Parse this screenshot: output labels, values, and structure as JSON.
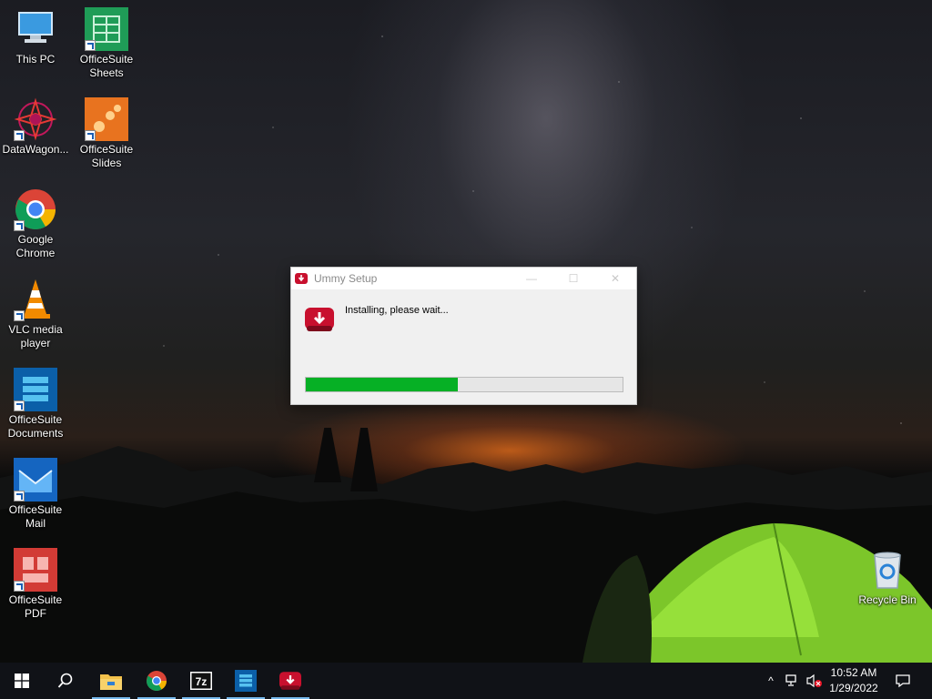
{
  "desktop": {
    "icons": [
      {
        "label": "This PC",
        "icon": "this-pc-icon"
      },
      {
        "label": "OfficeSuite Sheets",
        "icon": "officesuite-sheets-icon"
      },
      {
        "label": "DataWagon...",
        "icon": "datawagon-icon"
      },
      {
        "label": "OfficeSuite Slides",
        "icon": "officesuite-slides-icon"
      },
      {
        "label": "Google Chrome",
        "icon": "chrome-icon"
      },
      {
        "label": "VLC media player",
        "icon": "vlc-icon"
      },
      {
        "label": "OfficeSuite Documents",
        "icon": "officesuite-documents-icon"
      },
      {
        "label": "OfficeSuite Mail",
        "icon": "officesuite-mail-icon"
      },
      {
        "label": "OfficeSuite PDF",
        "icon": "officesuite-pdf-icon"
      },
      {
        "label": "Recycle Bin",
        "icon": "recycle-bin-icon"
      }
    ]
  },
  "dialog": {
    "title": "Ummy Setup",
    "status": "Installing, please wait...",
    "progress_fraction": 0.48,
    "buttons": {
      "minimize": "—",
      "maximize": "☐",
      "close": "✕"
    }
  },
  "taskbar": {
    "start_icon": "windows-start-icon",
    "search_icon": "search-icon",
    "apps": [
      "file-explorer-icon",
      "chrome-icon",
      "7zip-icon",
      "officesuite-documents-icon",
      "ummy-icon"
    ],
    "tray": {
      "chevron": "^",
      "time": "10:52 AM",
      "date": "1/29/2022"
    }
  },
  "colors": {
    "progress": "#06b025",
    "ummy_red": "#c8102e",
    "taskbar": "#101217"
  }
}
